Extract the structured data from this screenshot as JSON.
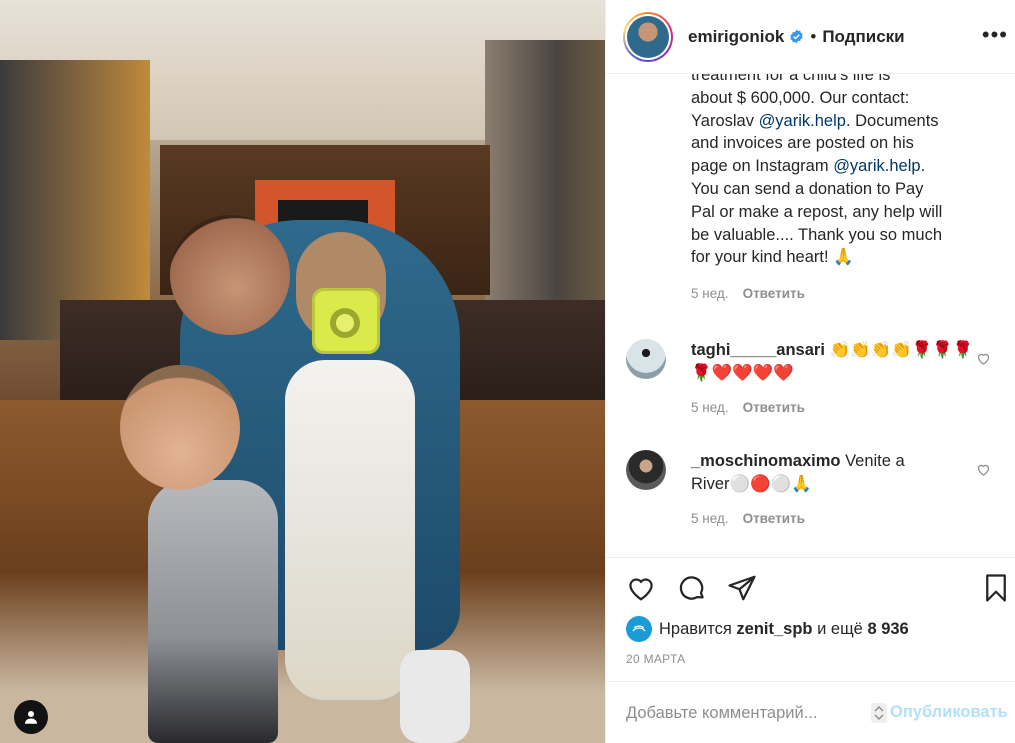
{
  "post": {
    "author": "emirigoniok",
    "separator": "•",
    "follow_label": "Подписки",
    "more_label": "•••"
  },
  "caption": {
    "lines": [
      "treatment for a child's life is",
      "about $ 600,000. Our contact:",
      "Yaroslav ",
      "@yarik.help",
      ". Documents",
      "and invoices are posted on his",
      "page on Instagram ",
      "@yarik.help",
      ".",
      "You can send a donation to Pay",
      "Pal or make a repost, any help will",
      "be valuable.... Thank you so much",
      "for your kind heart! 🙏"
    ],
    "age": "5 нед.",
    "reply": "Ответить"
  },
  "comments": [
    {
      "username": "taghi_____ansari",
      "text": "👏👏👏👏🌹🌹🌹🌹❤️❤️❤️❤️",
      "age": "5 нед.",
      "reply": "Ответить"
    },
    {
      "username": "_moschinomaximo",
      "text": "Venite a River⚪🔴⚪🙏",
      "age": "5 нед.",
      "reply": "Ответить"
    }
  ],
  "likes": {
    "prefix": "Нравится",
    "user": "zenit_spb",
    "middle": "и ещё",
    "count": "8 936"
  },
  "date": "20 МАРТА",
  "add_comment": {
    "placeholder": "Добавьте комментарий...",
    "publish": "Опубликовать"
  },
  "colors": {
    "verified": "#3897f0",
    "link": "#00376b",
    "publish_disabled": "#b2dffc"
  }
}
